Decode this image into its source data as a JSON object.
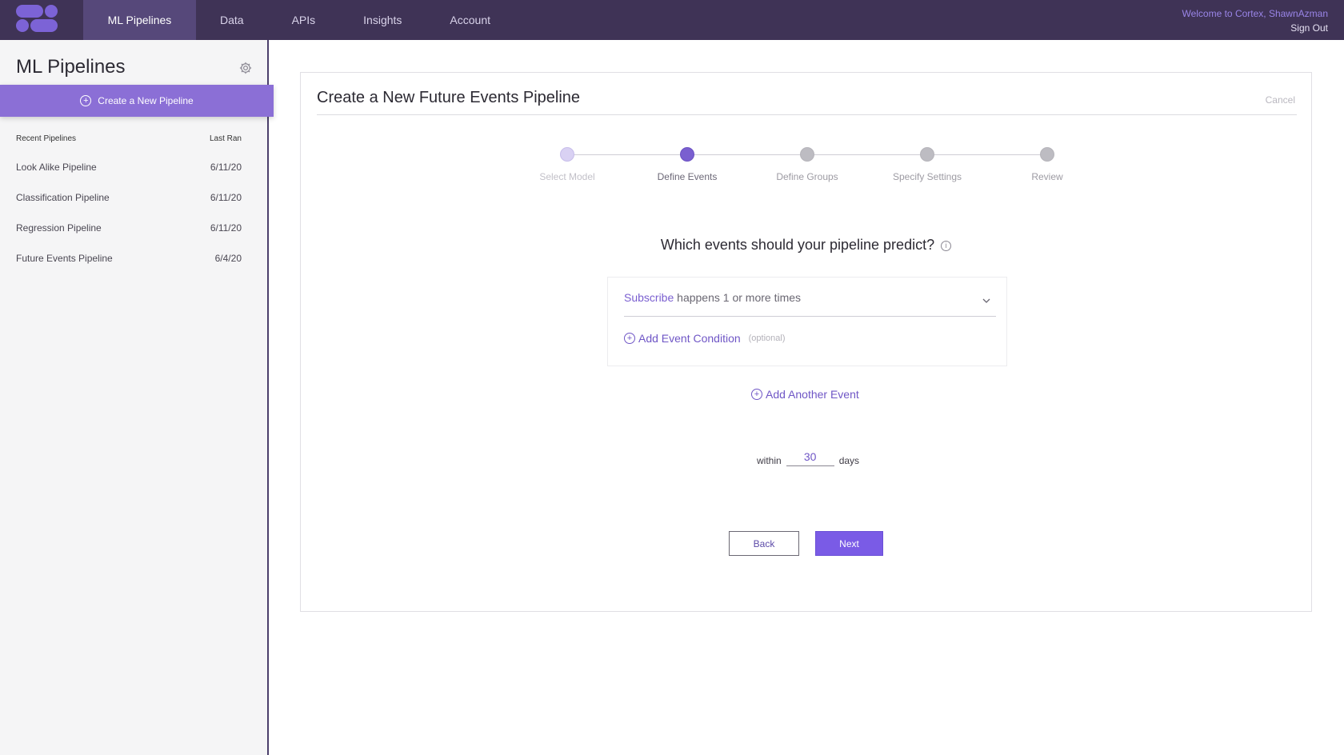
{
  "nav": {
    "items": [
      "ML Pipelines",
      "Data",
      "APIs",
      "Insights",
      "Account"
    ],
    "active": "ML Pipelines",
    "welcome": "Welcome to Cortex, ShawnAzman",
    "sign_out": "Sign Out",
    "logo_icon": "cortex-logo-icon"
  },
  "sidebar": {
    "title": "ML Pipelines",
    "settings_icon": "gear-icon",
    "create_label": "Create a New Pipeline",
    "recent_header": "Recent Pipelines",
    "last_ran_header": "Last Ran",
    "pipelines": [
      {
        "name": "Look Alike Pipeline",
        "date": "6/11/20"
      },
      {
        "name": "Classification Pipeline",
        "date": "6/11/20"
      },
      {
        "name": "Regression Pipeline",
        "date": "6/11/20"
      },
      {
        "name": "Future Events Pipeline",
        "date": "6/4/20"
      }
    ]
  },
  "main": {
    "title": "Create a New Future Events Pipeline",
    "cancel": "Cancel",
    "steps": [
      {
        "label": "Select Model",
        "state": "done"
      },
      {
        "label": "Define Events",
        "state": "active"
      },
      {
        "label": "Define Groups",
        "state": "pending"
      },
      {
        "label": "Specify Settings",
        "state": "pending"
      },
      {
        "label": "Review",
        "state": "pending"
      }
    ],
    "question": "Which events should your pipeline predict?",
    "event": {
      "name": "Subscribe",
      "rule": "happens 1 or more times"
    },
    "add_condition": "Add Event Condition",
    "optional": "(optional)",
    "add_another": "Add Another Event",
    "within_label": "within",
    "within_value": "30",
    "days_label": "days",
    "back": "Back",
    "next": "Next"
  },
  "colors": {
    "nav_bg": "#3f3356",
    "accent": "#7a5be6",
    "sidebar_bg": "#f5f5f6"
  }
}
